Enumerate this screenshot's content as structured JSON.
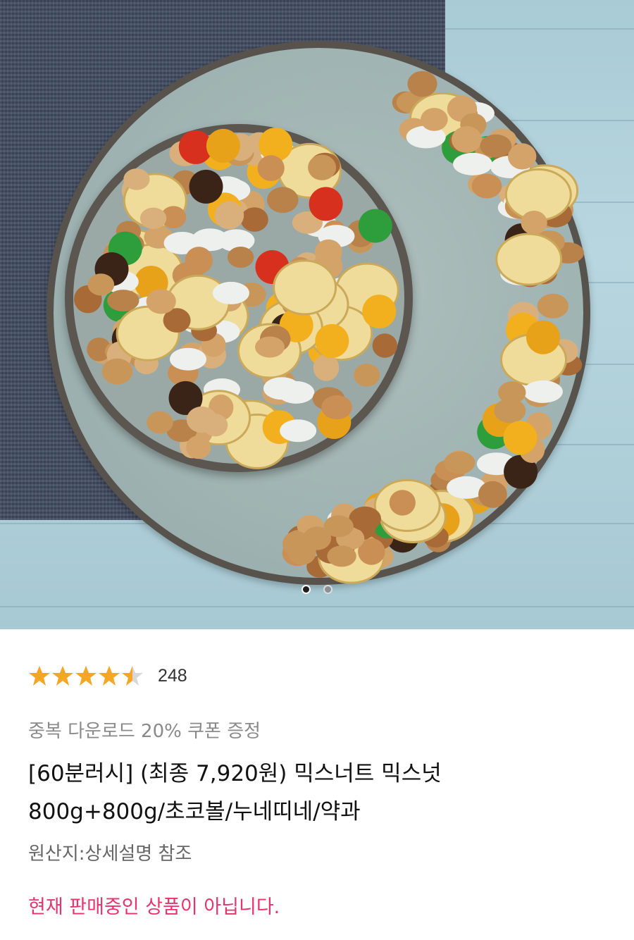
{
  "gallery": {
    "image_alt": "믹스너트 믹스넛",
    "current_index": 1,
    "total": 2
  },
  "rating": {
    "stars_value": 4.5,
    "stars_max": 5,
    "review_count": "248",
    "star_color": "#f5a623"
  },
  "product": {
    "coupon_text": "중복 다운로드 20% 쿠폰 증정",
    "title_line1": "[60분러시] (최종 7,920원) 믹스너트 믹스넛",
    "title_line2": "800g+800g/초코볼/누네띠네/약과",
    "origin": "원산지:상세설명 참조",
    "status": "현재 판매중인 상품이 아닙니다.",
    "status_color": "#e8336b"
  }
}
